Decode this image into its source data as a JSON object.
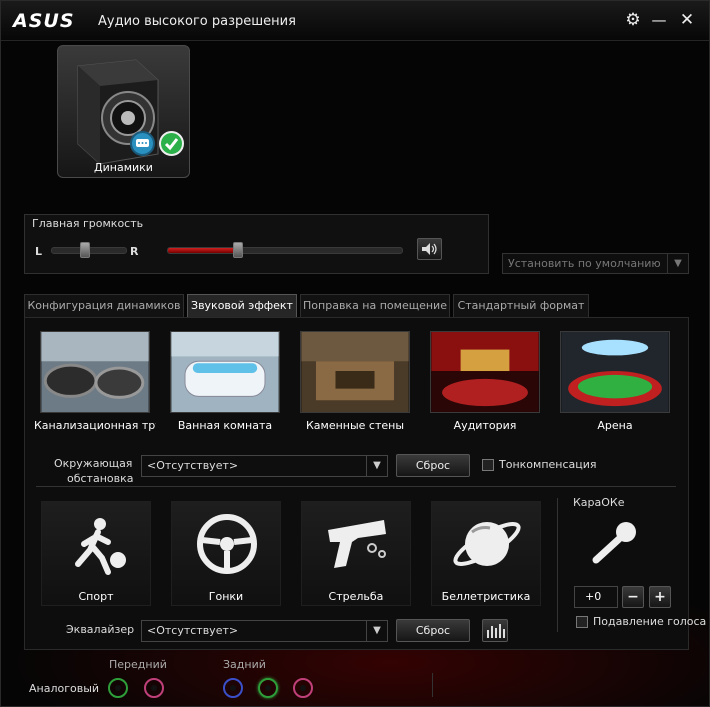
{
  "app": {
    "logo": "ASUS",
    "title": "Аудио высокого разрешения"
  },
  "device": {
    "label": "Динамики"
  },
  "volume": {
    "title": "Главная громкость",
    "left": "L",
    "right": "R",
    "balance_level": 0.45,
    "master_level": 0.3
  },
  "set_default": {
    "label": "Установить по умолчанию"
  },
  "tabs": [
    {
      "label": "Конфигурация динамиков"
    },
    {
      "label": "Звуковой эффект"
    },
    {
      "label": "Поправка на помещение"
    },
    {
      "label": "Стандартный формат"
    }
  ],
  "environments": [
    {
      "label": "Канализационная труба"
    },
    {
      "label": "Ванная комната"
    },
    {
      "label": "Каменные стены"
    },
    {
      "label": "Аудитория"
    },
    {
      "label": "Арена"
    }
  ],
  "environment_row": {
    "label_line1": "Окружающая",
    "label_line2": "обстановка",
    "value": "<Отсутствует>",
    "reset": "Сброс",
    "loudness": "Тонкомпенсация"
  },
  "games": [
    {
      "label": "Спорт"
    },
    {
      "label": "Гонки"
    },
    {
      "label": "Стрельба"
    },
    {
      "label": "Беллетристика"
    }
  ],
  "karaoke": {
    "title": "КараОКе",
    "value": "+0",
    "minus": "−",
    "plus": "+",
    "suppress": "Подавление голоса"
  },
  "equalizer": {
    "label": "Эквалайзер",
    "value": "<Отсутствует>",
    "reset": "Сброс"
  },
  "bottom": {
    "analog": "Аналоговый",
    "front": "Передний",
    "rear": "Задний"
  },
  "colors": {
    "accent_red": "#b01818",
    "jack_green": "#2e9e3a",
    "jack_pink": "#c0407a",
    "jack_blue": "#3a4fc8",
    "check_green": "#2bb04a",
    "chat_blue": "#2a90c0"
  }
}
